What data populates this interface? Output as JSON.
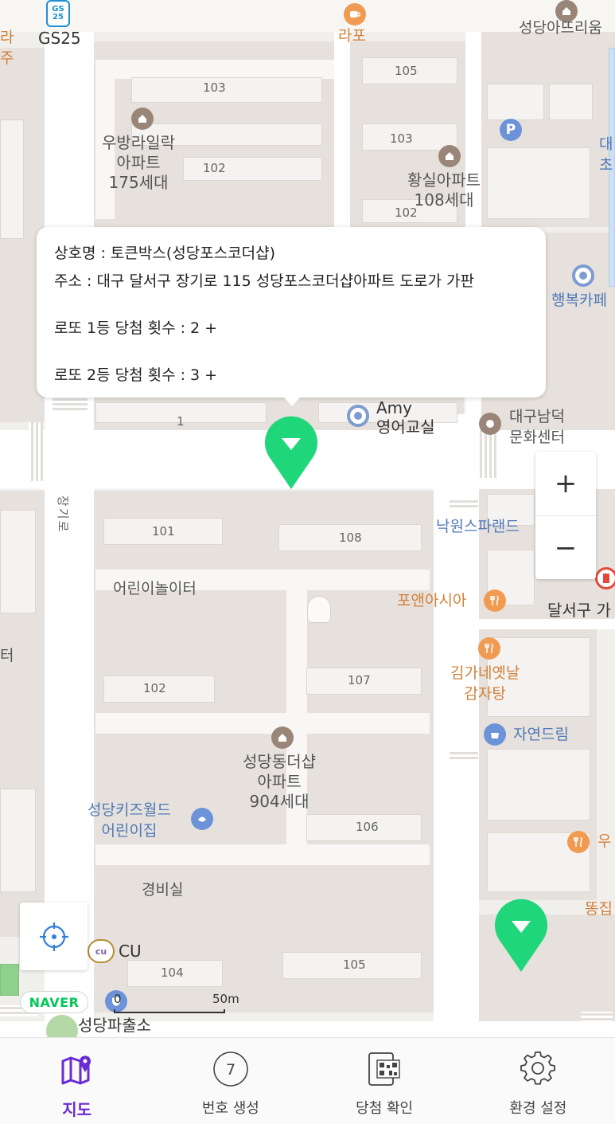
{
  "map": {
    "apt_labels": [
      "103",
      "102",
      "105",
      "103",
      "102",
      "101",
      "108",
      "102",
      "107",
      "106",
      "105",
      "104",
      "1"
    ],
    "places": {
      "gs25": "GS25",
      "gs25_logo": "GS 25",
      "rapo": "라포",
      "seongdang_top": "성당아뜨리움",
      "ubang": "우방라일락\n아파트\n175세대",
      "hwangsil": "황실아파트\n108세대",
      "haengbok": "행복카페",
      "amy": "Amy\n영어교실",
      "daegu_center": "대구남덕\n문화센터",
      "nakwon": "낙원스파랜드",
      "poan": "포앤아시아",
      "dalseo": "달서구 가",
      "gimga": "김가네옛날\n감자탕",
      "jayeon": "자연드림",
      "kids_play": "어린이놀이터",
      "seongdong_apt": "성당동더샵\n아파트\n904세대",
      "kids_world": "성당키즈월드\n어린이집",
      "guard": "경비실",
      "cu": "CU",
      "police": "성당파출소",
      "road_vertical": "장기로",
      "ttong": "똥집",
      "u": "우",
      "edge_left1": "라",
      "edge_left2": "주",
      "edge_left3": "터",
      "edge_right1": "대",
      "edge_right2": "초"
    },
    "scale": {
      "zero": "0",
      "dist": "50m"
    },
    "naver_logo": "NAVER",
    "zoom_in": "+",
    "zoom_out": "−"
  },
  "info": {
    "name_line": "상호명 : 토큰박스(성당포스코더샵)",
    "address_line": "주소 : 대구 달서구 장기로 115 성당포스코더샵아파트 도로가 가판",
    "first_prize_line": "로또 1등 당첨 횟수 :  2 +",
    "second_prize_line": "로또 2등 당첨 횟수 :  3 +"
  },
  "nav": {
    "tabs": [
      {
        "label": "지도",
        "icon": "map-pin-icon",
        "active": true
      },
      {
        "label": "번호 생성",
        "icon": "number-ball-icon",
        "ball_number": "7"
      },
      {
        "label": "당첨 확인",
        "icon": "qr-scan-icon"
      },
      {
        "label": "환경 설정",
        "icon": "gear-icon"
      }
    ]
  },
  "colors": {
    "marker": "#1fd67a",
    "active_tab": "#6a2bd3",
    "naver": "#03c75a"
  }
}
